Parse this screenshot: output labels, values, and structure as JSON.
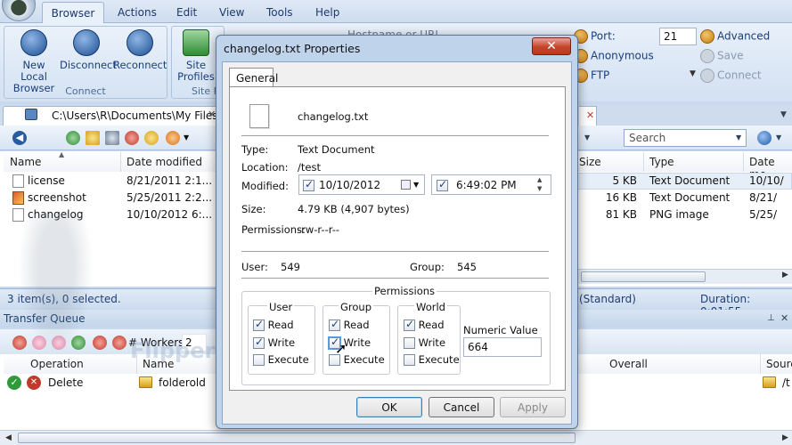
{
  "menubar": {
    "items": [
      "Browser",
      "Actions",
      "Edit",
      "View",
      "Tools",
      "Help"
    ]
  },
  "ribbon": {
    "connect_group": {
      "label": "Connect",
      "buttons": [
        "New Local Browser",
        "Disconnect",
        "Reconnect"
      ]
    },
    "site_group": {
      "label": "Site P",
      "button": "Site Profiles"
    },
    "hostname_placeholder": "Hostname or URL",
    "port_label": "Port:",
    "port_value": "21",
    "advanced": "Advanced",
    "save": "Save",
    "anonymous": "Anonymous",
    "ftp": "FTP",
    "connect": "Connect"
  },
  "local": {
    "path": "C:\\Users\\R\\Documents\\My Files",
    "columns": [
      "Name",
      "Date modified"
    ],
    "files": [
      {
        "name": "license",
        "date": "8/21/2011 2:1..."
      },
      {
        "name": "screenshot",
        "date": "5/25/2011 2:2..."
      },
      {
        "name": "changelog",
        "date": "10/10/2012 6:..."
      }
    ],
    "status": "3 item(s), 0 selected."
  },
  "remote": {
    "search_placeholder": "Search",
    "columns": [
      "Size",
      "Type",
      "Date mo"
    ],
    "rows": [
      {
        "size": "5 KB",
        "type": "Text Document",
        "date": "10/10/"
      },
      {
        "size": "16 KB",
        "type": "Text Document",
        "date": "8/21/"
      },
      {
        "size": "81 KB",
        "type": "PNG image",
        "date": "5/25/"
      }
    ],
    "status_mode": "(Standard)",
    "duration": "Duration: 0:01:55"
  },
  "queue": {
    "title": "Transfer Queue",
    "workers_label": "# Workers",
    "workers_value": "2",
    "columns": [
      "Operation",
      "Name",
      "Overall",
      "Sourc"
    ],
    "rows": [
      {
        "operation": "Delete",
        "name": "folderold",
        "source": "/t"
      }
    ]
  },
  "watermark": {
    "text": "FlipperHost"
  },
  "dialog": {
    "title": "changelog.txt Properties",
    "close": "✕",
    "tab": "General",
    "filename": "changelog.txt",
    "type_label": "Type:",
    "type_value": "Text Document",
    "location_label": "Location:",
    "location_value": "/test",
    "modified_label": "Modified:",
    "modified_date": "10/10/2012",
    "modified_time": "6:49:02 PM",
    "size_label": "Size:",
    "size_value": "4.79 KB (4,907 bytes)",
    "permissions_label": "Permissions:",
    "permissions_value": "-rw-r--r--",
    "user_label": "User:",
    "user_value": "549",
    "group_label": "Group:",
    "group_value": "545",
    "perm_title": "Permissions",
    "user_box": {
      "title": "User",
      "read": "Read",
      "write": "Write",
      "execute": "Execute"
    },
    "group_box": {
      "title": "Group",
      "read": "Read",
      "write": "Write",
      "execute": "Execute"
    },
    "world_box": {
      "title": "World",
      "read": "Read",
      "write": "Write",
      "execute": "Execute"
    },
    "numeric_label": "Numeric Value",
    "numeric_value": "664",
    "ok": "OK",
    "cancel": "Cancel",
    "apply": "Apply"
  }
}
